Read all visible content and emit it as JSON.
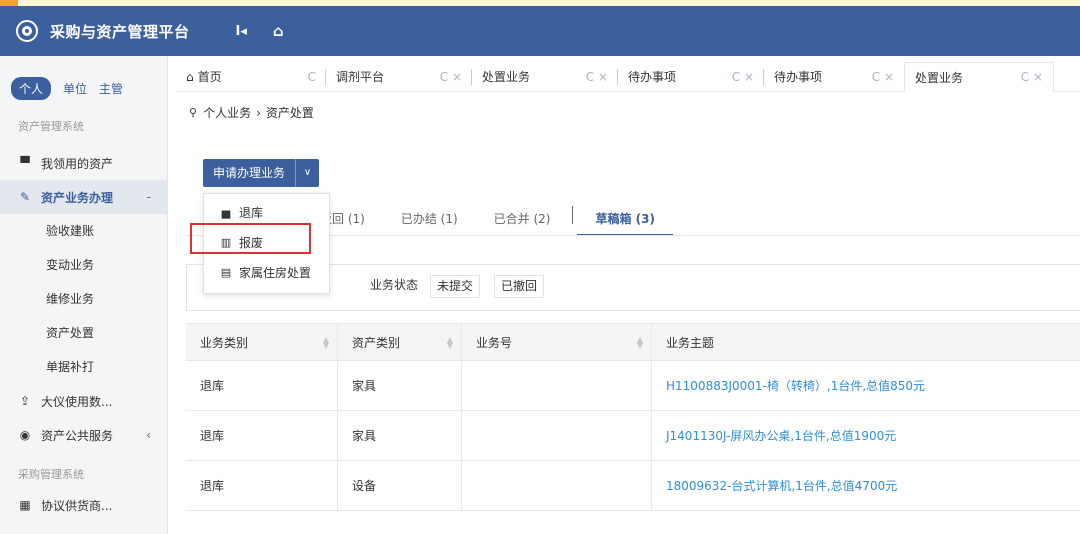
{
  "app": {
    "title": "采购与资产管理平台"
  },
  "sidebar": {
    "role_tabs": [
      "个人",
      "单位",
      "主管"
    ],
    "group1_title": "资产管理系统",
    "items": [
      {
        "label": "我领用的资产",
        "icon": "desktop-icon"
      },
      {
        "label": "资产业务办理",
        "icon": "pencil-icon",
        "tail": "-"
      }
    ],
    "subitems": [
      "验收建账",
      "变动业务",
      "维修业务",
      "资产处置",
      "单据补打"
    ],
    "items2": [
      {
        "label": "大仪使用数...",
        "icon": "upload-icon"
      },
      {
        "label": "资产公共服务",
        "icon": "globe-icon",
        "tail": "‹"
      }
    ],
    "group2_title": "采购管理系统",
    "items3": [
      {
        "label": "协议供货商...",
        "icon": "grid-icon"
      }
    ]
  },
  "tabs": [
    {
      "label": "首页",
      "ctrl": "C"
    },
    {
      "label": "调剂平台",
      "ctrl": "C ×"
    },
    {
      "label": "处置业务",
      "ctrl": "C ×"
    },
    {
      "label": "待办事项",
      "ctrl": "C ×"
    },
    {
      "label": "待办事项",
      "ctrl": "C ×"
    },
    {
      "label": "处置业务",
      "ctrl": "C ×"
    }
  ],
  "breadcrumb": {
    "first": "个人业务",
    "sep": "›",
    "second": "资产处置"
  },
  "apply_button": {
    "label": "申请办理业务"
  },
  "dropdown": {
    "items": [
      "退库",
      "报废",
      "家属住房处置"
    ]
  },
  "status_tabs": {
    "t1": "驳回 (1)",
    "t2": "已办结 (1)",
    "t3": "已合并 (2)",
    "t4": "草稿箱 (3)"
  },
  "filter": {
    "label": "业务状态",
    "options": [
      "未提交",
      "已撤回"
    ]
  },
  "table": {
    "headers": [
      "业务类别",
      "资产类别",
      "业务号",
      "业务主题"
    ],
    "rows": [
      {
        "category": "退库",
        "asset_type": "家具",
        "number": "",
        "subject": "H1100883J0001-椅（转椅）,1台件,总值850元"
      },
      {
        "category": "退库",
        "asset_type": "家具",
        "number": "",
        "subject": "J1401130J-屏风办公桌,1台件,总值1900元"
      },
      {
        "category": "退库",
        "asset_type": "设备",
        "number": "",
        "subject": "18009632-台式计算机,1台件,总值4700元"
      }
    ]
  },
  "colors": {
    "primary": "#3c5f9e",
    "link": "#2f8fd8",
    "highlight": "#e03030"
  }
}
